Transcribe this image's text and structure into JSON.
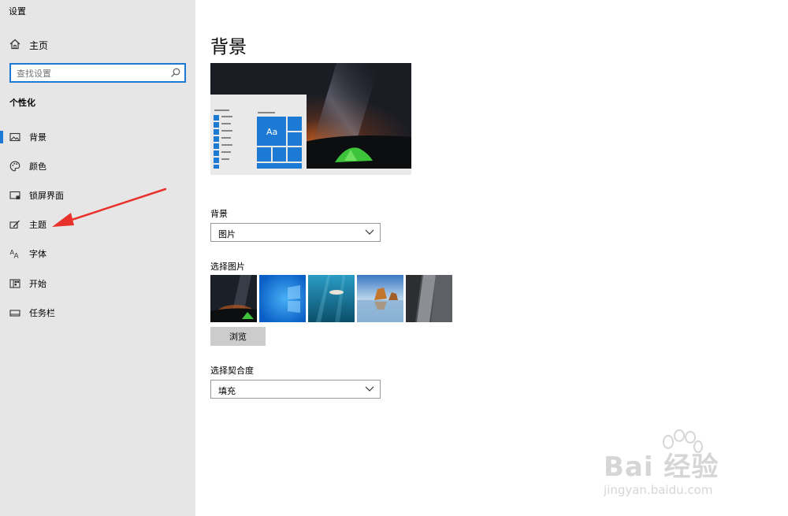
{
  "window": {
    "title": "设置"
  },
  "sidebar": {
    "home_label": "主页",
    "search_placeholder": "查找设置",
    "section_title": "个性化",
    "items": [
      {
        "label": "背景",
        "icon": "picture-icon",
        "selected": true
      },
      {
        "label": "颜色",
        "icon": "palette-icon",
        "selected": false
      },
      {
        "label": "锁屏界面",
        "icon": "lock-screen-icon",
        "selected": false
      },
      {
        "label": "主题",
        "icon": "theme-brush-icon",
        "selected": false
      },
      {
        "label": "字体",
        "icon": "font-icon",
        "selected": false
      },
      {
        "label": "开始",
        "icon": "start-menu-icon",
        "selected": false
      },
      {
        "label": "任务栏",
        "icon": "taskbar-icon",
        "selected": false
      }
    ]
  },
  "main": {
    "title": "背景",
    "background_label": "背景",
    "background_value": "图片",
    "choose_picture_label": "选择图片",
    "browse_label": "浏览",
    "fit_label": "选择契合度",
    "fit_value": "填充",
    "preview_tile_label": "Aa"
  },
  "watermark": {
    "brand": "Bai 经验",
    "url": "jingyan.baidu.com"
  },
  "colors": {
    "accent": "#1c7ad4",
    "sidebar_bg": "#e6e6e6",
    "annotation_arrow": "#e8322b"
  }
}
